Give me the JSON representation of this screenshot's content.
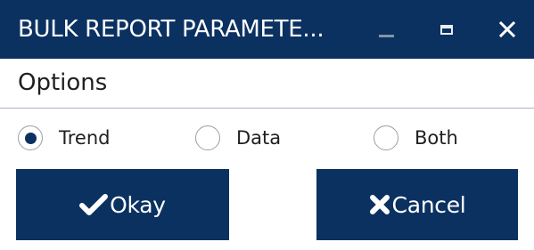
{
  "window": {
    "title": "BULK REPORT PARAMETE...",
    "controls": {
      "minimize_icon": "minimize-icon",
      "maximize_icon": "maximize-icon",
      "close_icon": "close-icon",
      "close_glyph": "✕"
    }
  },
  "options": {
    "heading": "Options",
    "radios": [
      {
        "label": "Trend",
        "selected": true
      },
      {
        "label": "Data",
        "selected": false
      },
      {
        "label": "Both",
        "selected": false
      }
    ]
  },
  "buttons": {
    "okay": {
      "label": "Okay",
      "icon": "checkmark-icon"
    },
    "cancel": {
      "label": "Cancel",
      "icon": "x-mark-icon"
    }
  },
  "colors": {
    "brand": "#0b3161",
    "text": "#1f1f1f",
    "divider": "#a9b3c1"
  }
}
